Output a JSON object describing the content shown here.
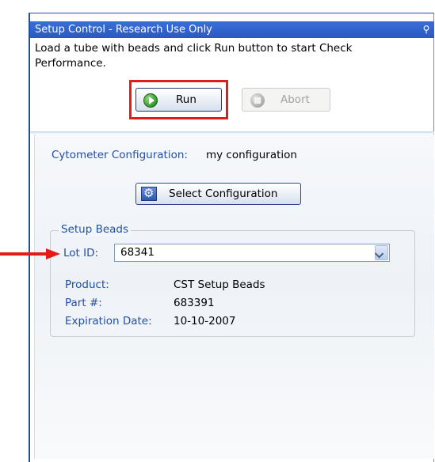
{
  "window": {
    "title": "Setup Control - Research Use Only",
    "pin_icon": "pin-icon"
  },
  "instructions": "Load a tube with beads and click Run button to start Check Performance.",
  "buttons": {
    "run_label": "Run",
    "abort_label": "Abort",
    "select_configuration_label": "Select Configuration"
  },
  "cytometer": {
    "label": "Cytometer Configuration:",
    "value": "my configuration"
  },
  "setup_beads": {
    "legend": "Setup Beads",
    "lot_id_label": "Lot ID:",
    "lot_id_value": "68341",
    "details": [
      {
        "label": "Product:",
        "value": "CST Setup Beads"
      },
      {
        "label": "Part #:",
        "value": "683391"
      },
      {
        "label": "Expiration Date:",
        "value": "10-10-2007"
      }
    ]
  },
  "colors": {
    "title_bar": "#2a58c0",
    "label_blue": "#1f4fa8",
    "highlight_red": "#e21b1b"
  }
}
